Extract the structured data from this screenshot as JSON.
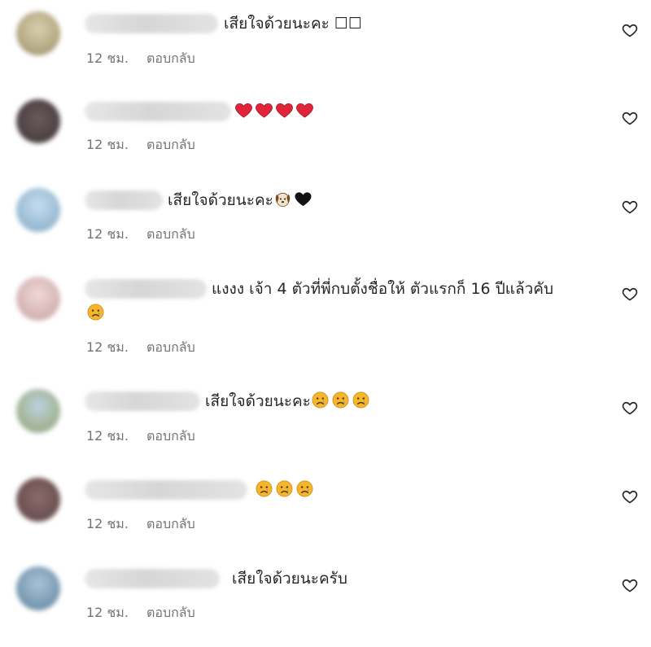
{
  "icons": {
    "like": "heart-outline-icon",
    "sad": "sad-face-emoji",
    "heart": "red-heart-emoji",
    "dog": "dog-face-emoji",
    "black_heart": "black-heart-emoji"
  },
  "colors": {
    "text": "#262626",
    "meta": "#737373",
    "heart_emoji": "#e0243a",
    "sad_emoji": "#f5b62c"
  },
  "comments": [
    {
      "text": "เสียใจด้วยนะคะ ☐☐",
      "time": "12 ชม.",
      "reply": "ตอบกลับ"
    },
    {
      "text": "",
      "time": "12 ชม.",
      "reply": "ตอบกลับ"
    },
    {
      "text": "เสียใจด้วยนะคะ",
      "time": "12 ชม.",
      "reply": "ตอบกลับ"
    },
    {
      "text": "แงงง เจ้า 4 ตัวที่พี่กบตั้งชื่อให้ ตัวแรกก็ 16 ปีแล้วคับ",
      "time": "12 ชม.",
      "reply": "ตอบกลับ"
    },
    {
      "text": "เสียใจด้วยนะคะ",
      "time": "12 ชม.",
      "reply": "ตอบกลับ"
    },
    {
      "text": "",
      "time": "12 ชม.",
      "reply": "ตอบกลับ"
    },
    {
      "text": "เสียใจด้วยนะครับ",
      "time": "12 ชม.",
      "reply": "ตอบกลับ"
    }
  ]
}
